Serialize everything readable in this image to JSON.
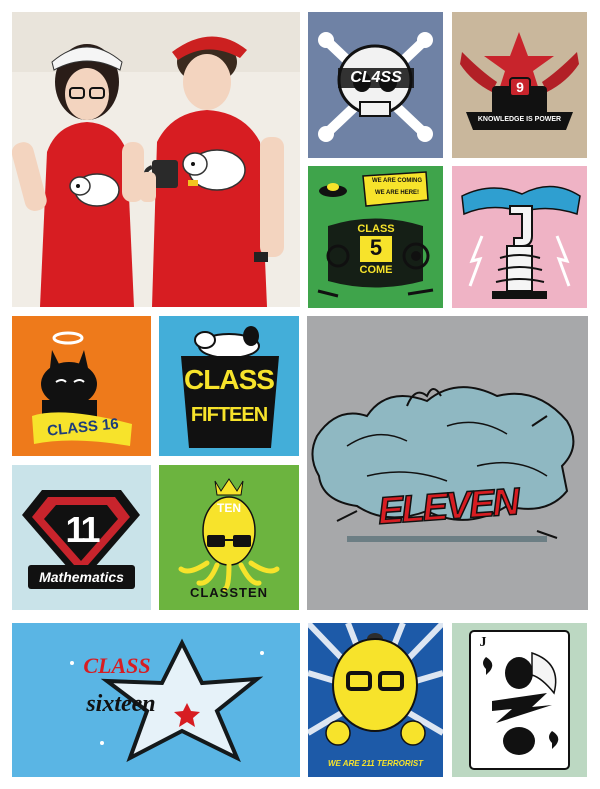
{
  "colors": {
    "page_bg": "#ffffff",
    "photo_bg": "#f2efe9",
    "shirt_red": "#d71d22",
    "blue_gray": "#6f82a5",
    "khaki": "#c9b79c",
    "green": "#3fa44b",
    "pink": "#efb3c5",
    "orange": "#ee7a1b",
    "cyan": "#43aed9",
    "gray": "#a7a8aa",
    "pale_blue": "#c9e3e9",
    "lime": "#6cb43f",
    "sky": "#5ab5e4",
    "royal_blue": "#1d5aa8",
    "mint": "#bcd8c2",
    "yellow": "#f7e32b",
    "black": "#111111"
  },
  "tiles": {
    "photo": {
      "icon": "couple-red-tshirts-sheep-photo"
    },
    "skull": {
      "text": "CL4SS",
      "icon": "skull-crossbones-icon"
    },
    "knowledge": {
      "text": "KNOWLEDGE IS POWER",
      "number": "9",
      "icon": "winged-star-emblem-icon"
    },
    "aliens": {
      "top": "WE ARE COMING",
      "middle": "WE ARE HERE!",
      "line1": "CLASS",
      "line2": "5",
      "line3": "COME",
      "icon": "ufo-alien-icon"
    },
    "tower": {
      "icon": "pipe-tower-icon"
    },
    "bunny": {
      "text": "CLASS 16",
      "icon": "angel-bunny-icon"
    },
    "snoopy": {
      "line1": "CLASS",
      "line2": "FIFTEEN",
      "icon": "sleeping-dog-icon"
    },
    "eleven": {
      "text": "ELEVEN",
      "icon": "smoke-cloud-icon"
    },
    "math": {
      "number": "11",
      "text": "Mathematics",
      "icon": "super-emblem-icon"
    },
    "octopus": {
      "top": "TEN",
      "bottom": "CLASSTEN",
      "icon": "octopus-glasses-icon"
    },
    "star": {
      "line1": "CLASS",
      "line2": "sixteen",
      "icon": "star-outline-icon"
    },
    "terrorist": {
      "text": "WE ARE 211 TERRORIST",
      "icon": "nerd-faces-icon"
    },
    "card": {
      "rank": "J",
      "icon": "playing-card-jack-icon"
    }
  }
}
